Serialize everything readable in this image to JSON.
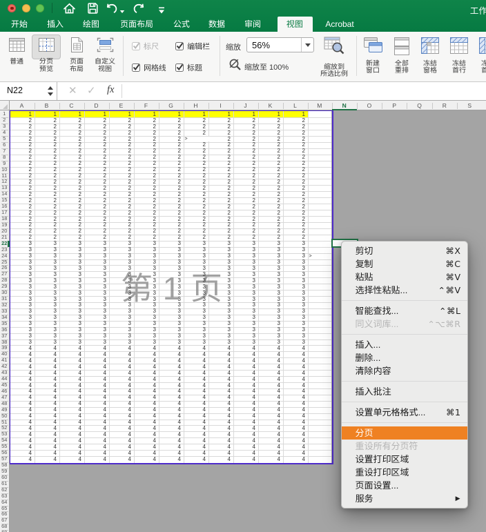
{
  "titlebar": {
    "document_title": "工作",
    "toolbar_icons": [
      "home-icon",
      "save-icon",
      "undo-icon",
      "redo-icon",
      "customize-toolbar-icon"
    ]
  },
  "ribbon_tabs": [
    {
      "label": "开始",
      "active": false
    },
    {
      "label": "插入",
      "active": false
    },
    {
      "label": "绘图",
      "active": false
    },
    {
      "label": "页面布局",
      "active": false
    },
    {
      "label": "公式",
      "active": false
    },
    {
      "label": "数据",
      "active": false
    },
    {
      "label": "审阅",
      "active": false
    },
    {
      "label": "视图",
      "active": true
    },
    {
      "label": "Acrobat",
      "active": false
    }
  ],
  "ribbon": {
    "view_group": [
      {
        "lines": [
          "普通"
        ],
        "icon": "normal-view-icon",
        "active": false
      },
      {
        "lines": [
          "分页",
          "预览"
        ],
        "icon": "page-break-preview-icon",
        "active": true
      },
      {
        "lines": [
          "页面",
          "布局"
        ],
        "icon": "page-layout-icon",
        "active": false
      },
      {
        "lines": [
          "自定义",
          "视图"
        ],
        "icon": "custom-views-icon",
        "active": false
      }
    ],
    "checkboxes": [
      {
        "label": "标尺",
        "checked": true,
        "enabled": false
      },
      {
        "label": "网格线",
        "checked": true,
        "enabled": true
      },
      {
        "label": "编辑栏",
        "checked": true,
        "enabled": true
      },
      {
        "label": "标题",
        "checked": true,
        "enabled": true
      }
    ],
    "zoom_group": {
      "zoom_label": "缩放",
      "zoom_value": "56%",
      "zoom_100_label": "缩放至 100%",
      "zoom_selection_lines": [
        "缩放到",
        "所选比例"
      ]
    },
    "window_group": [
      {
        "lines": [
          "新建",
          "窗口"
        ],
        "icon": "new-window-icon"
      },
      {
        "lines": [
          "全部",
          "重排"
        ],
        "icon": "arrange-all-icon"
      },
      {
        "lines": [
          "冻结",
          "窗格"
        ],
        "icon": "freeze-panes-icon"
      },
      {
        "lines": [
          "冻结",
          "首行"
        ],
        "icon": "freeze-top-row-icon"
      },
      {
        "lines": [
          "冻结",
          "首列"
        ],
        "icon": "freeze-first-col-icon"
      }
    ]
  },
  "formula_bar": {
    "name_box": "N22",
    "fx_label": "fx"
  },
  "grid": {
    "column_headers": [
      "A",
      "B",
      "C",
      "D",
      "E",
      "F",
      "G",
      "H",
      "I",
      "J",
      "K",
      "L",
      "M",
      "N",
      "O",
      "P",
      "Q",
      "R",
      "S"
    ],
    "data_columns": [
      "A",
      "B",
      "C",
      "D",
      "E",
      "F",
      "G",
      "H",
      "I",
      "J",
      "K",
      "L"
    ],
    "selected_column": "N",
    "selected_row": 22,
    "selected_cell": "N22",
    "value_bands": [
      {
        "from_row": 1,
        "to_row": 1,
        "value": "1",
        "highlight": "yellow"
      },
      {
        "from_row": 2,
        "to_row": 21,
        "value": "2"
      },
      {
        "from_row": 22,
        "to_row": 38,
        "value": "3"
      },
      {
        "from_row": 39,
        "to_row": 57,
        "value": "4"
      }
    ],
    "extra_cells": [
      {
        "column": "H",
        "row": 5,
        "value": ">",
        "overflows": true
      },
      {
        "column": "M",
        "row": 24,
        "value": ">",
        "overflows": true
      }
    ],
    "last_data_row": 57,
    "last_visible_row": 69,
    "watermark": "第 1 页"
  },
  "context_menu": {
    "items": [
      {
        "label": "剪切",
        "shortcut": "⌘X"
      },
      {
        "label": "复制",
        "shortcut": "⌘C"
      },
      {
        "label": "粘贴",
        "shortcut": "⌘V"
      },
      {
        "label": "选择性粘贴...",
        "shortcut": "⌃⌘V"
      },
      {
        "separator": true
      },
      {
        "label": "智能查找...",
        "shortcut": "⌃⌘L"
      },
      {
        "label": "同义词库...",
        "shortcut": "⌃⌥⌘R",
        "disabled": true
      },
      {
        "separator": true
      },
      {
        "label": "插入..."
      },
      {
        "label": "删除..."
      },
      {
        "label": "清除内容"
      },
      {
        "separator": true
      },
      {
        "label": "插入批注"
      },
      {
        "separator": true
      },
      {
        "label": "设置单元格格式...",
        "shortcut": "⌘1"
      },
      {
        "separator": true
      },
      {
        "label": "分页",
        "highlighted": true
      },
      {
        "label": "重设所有分页符",
        "disabled": true
      },
      {
        "label": "设置打印区域"
      },
      {
        "label": "重设打印区域"
      },
      {
        "label": "页面设置..."
      },
      {
        "label": "服务",
        "submenu": true
      }
    ]
  },
  "colors": {
    "excel_green": "#0E7D46",
    "selection_green": "#217346",
    "menu_highlight_orange": "#EF8122",
    "page_break_purple": "#4E2BCB",
    "row_highlight_yellow": "#FFFF00",
    "outside_area_gray": "#A4A4A4"
  }
}
